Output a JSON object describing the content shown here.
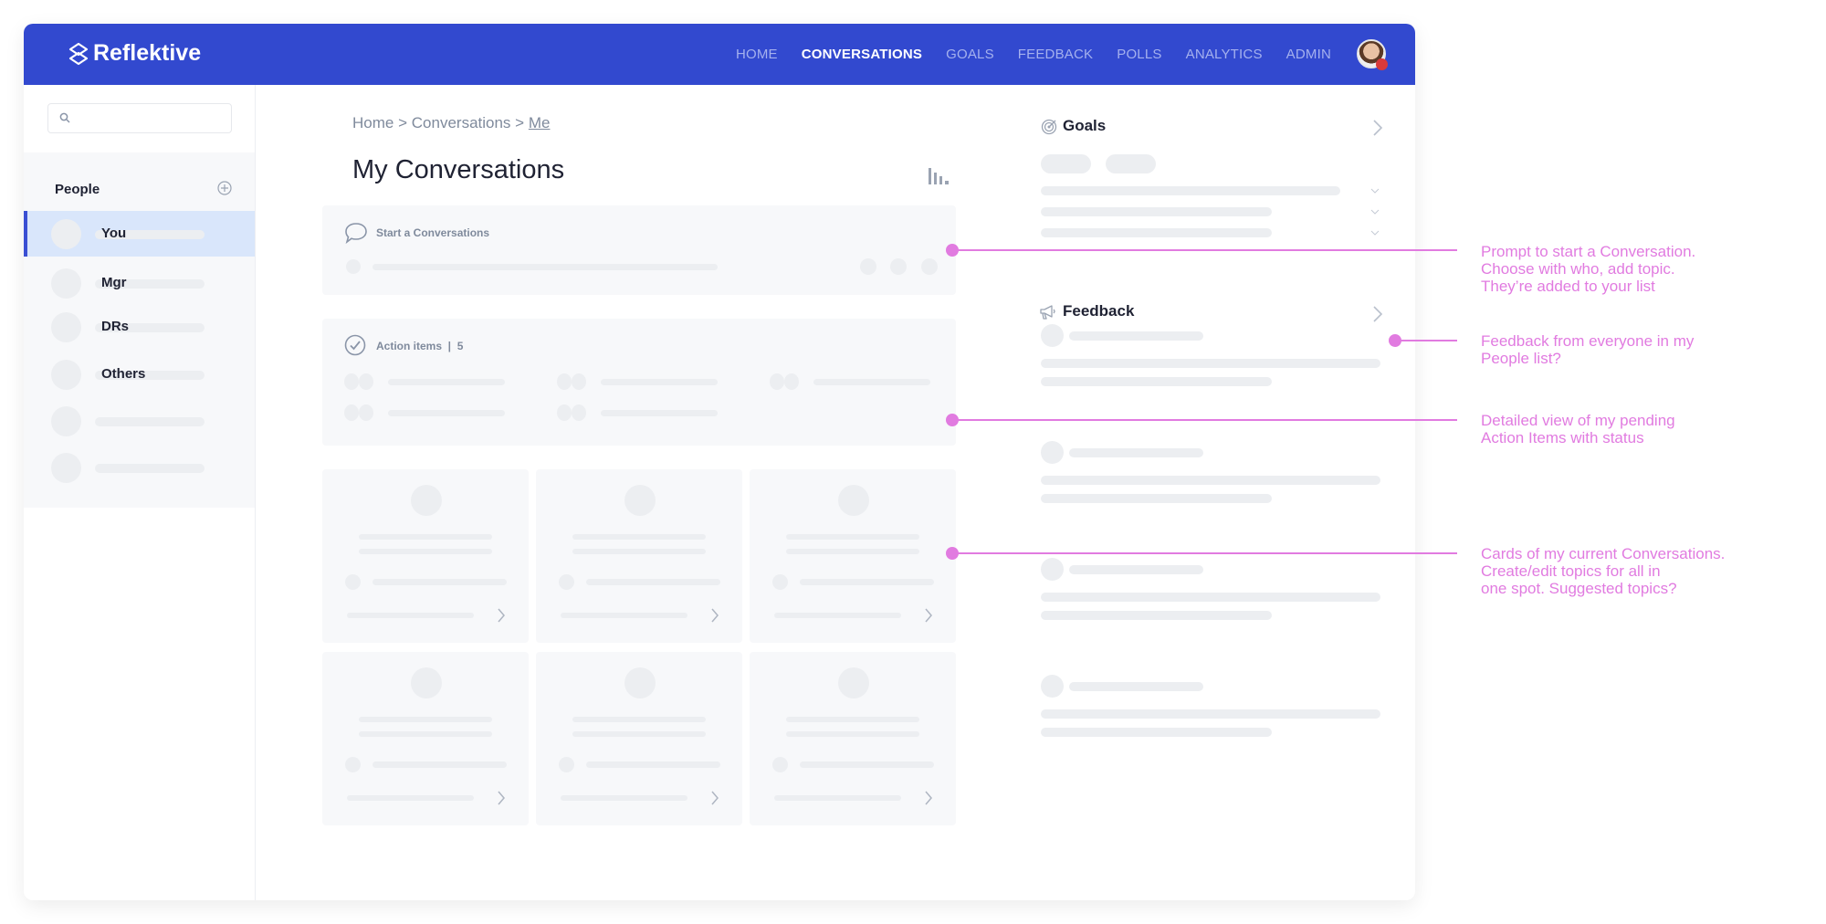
{
  "app": {
    "brand": "Reflektive",
    "brand_color": "#3249cf",
    "annotation_color": "#e17be0"
  },
  "nav": {
    "items": [
      {
        "label": "HOME",
        "active": false
      },
      {
        "label": "CONVERSATIONS",
        "active": true
      },
      {
        "label": "GOALS",
        "active": false
      },
      {
        "label": "FEEDBACK",
        "active": false
      },
      {
        "label": "POLLS",
        "active": false
      },
      {
        "label": "ANALYTICS",
        "active": false
      },
      {
        "label": "ADMIN",
        "active": false
      }
    ]
  },
  "sidebar": {
    "search_placeholder": "",
    "people_header": "People",
    "people": [
      {
        "name": "You",
        "active": true
      },
      {
        "name": "Mgr",
        "active": false
      },
      {
        "name": "DRs",
        "active": false
      },
      {
        "name": "Others",
        "active": false
      },
      {
        "name": "",
        "active": false
      },
      {
        "name": "",
        "active": false
      }
    ]
  },
  "main": {
    "breadcrumb": {
      "home": "Home",
      "sep": ">",
      "section": "Conversations",
      "current": "Me"
    },
    "title": "My Conversations",
    "start_panel": {
      "label": "Start a Conversations"
    },
    "action_items": {
      "label": "Action items",
      "count": "5"
    }
  },
  "right": {
    "goals_title": "Goals",
    "feedback_title": "Feedback"
  },
  "annotations": [
    {
      "text": "Prompt to start a Conversation.\nChoose with who, add topic.\nThey’re added to your list"
    },
    {
      "text": "Feedback from everyone in my\nPeople list?"
    },
    {
      "text": "Detailed view of my pending\nAction Items with status"
    },
    {
      "text": "Cards of my current Conversations.\nCreate/edit topics for all in\none spot. Suggested topics?"
    }
  ]
}
